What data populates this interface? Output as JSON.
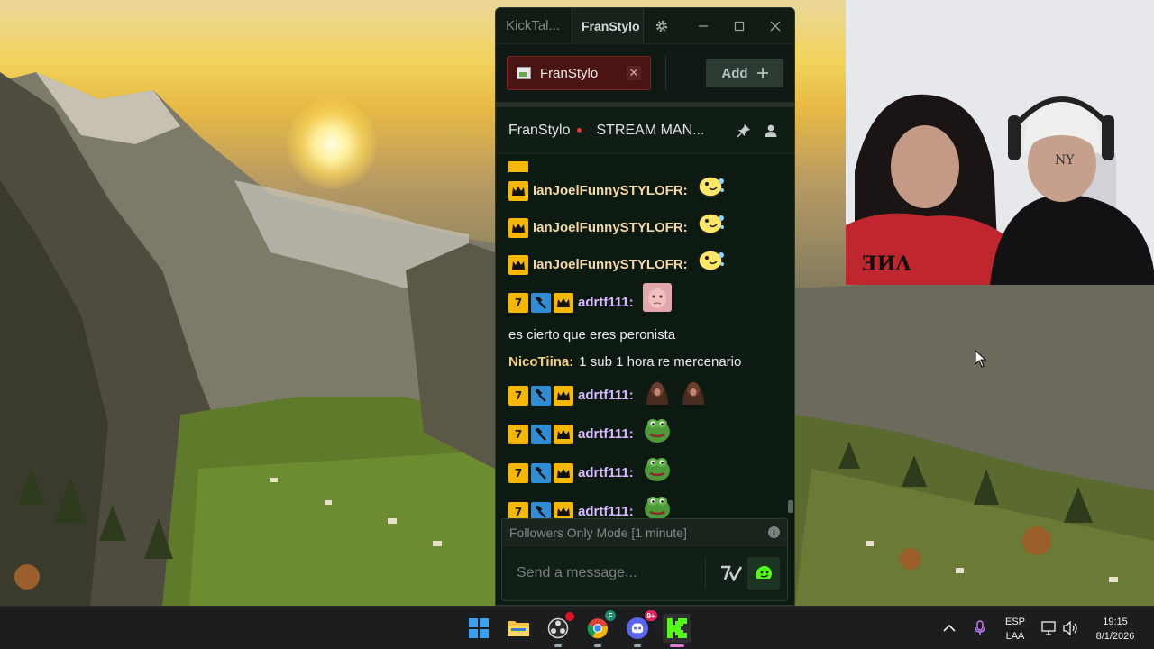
{
  "chat_app": {
    "app_title": "KickTal...",
    "active_tab": "FranStylo",
    "channel_tabs": [
      {
        "label": "FranStylo"
      }
    ],
    "add_label": "Add",
    "stream": {
      "channel": "FranStylo",
      "title": "STREAM MAÑ..."
    },
    "messages": [
      {
        "user": "IanJoelFunnySTYLOFR:",
        "badges": [
          "crown"
        ],
        "emotes": [
          "yellow-blob"
        ],
        "text": ""
      },
      {
        "user": "IanJoelFunnySTYLOFR:",
        "badges": [
          "crown"
        ],
        "emotes": [
          "yellow-blob"
        ],
        "text": ""
      },
      {
        "user": "IanJoelFunnySTYLOFR:",
        "badges": [
          "crown"
        ],
        "emotes": [
          "yellow-blob"
        ],
        "text": ""
      },
      {
        "user": "adrtf111:",
        "badges": [
          "seven",
          "hammer",
          "crown"
        ],
        "emotes": [
          "pink-face"
        ],
        "text": "es cierto que eres peronista"
      },
      {
        "user": "NicoTiina:",
        "badges": [],
        "emotes": [],
        "text": "1 sub 1 hora re mercenario"
      },
      {
        "user": "adrtf111:",
        "badges": [
          "seven",
          "hammer",
          "crown"
        ],
        "emotes": [
          "monkey",
          "monkey"
        ],
        "text": ""
      },
      {
        "user": "adrtf111:",
        "badges": [
          "seven",
          "hammer",
          "crown"
        ],
        "emotes": [
          "pepe"
        ],
        "text": ""
      },
      {
        "user": "adrtf111:",
        "badges": [
          "seven",
          "hammer",
          "crown"
        ],
        "emotes": [
          "pepe"
        ],
        "text": ""
      },
      {
        "user": "adrtf111:",
        "badges": [
          "seven",
          "hammer",
          "crown"
        ],
        "emotes": [
          "pepe"
        ],
        "text": ""
      }
    ],
    "composer": {
      "mode_notice": "Followers Only Mode [1 minute]",
      "placeholder": "Send a message..."
    }
  },
  "taskbar": {
    "apps": [
      "start",
      "file-explorer",
      "obs",
      "chrome",
      "discord",
      "kick"
    ],
    "discord_badge": "9+",
    "language_line1": "ESP",
    "language_line2": "LAA",
    "time": "19:15",
    "date": "8/1/2026"
  },
  "colors": {
    "accent_green": "#53fc18",
    "badge_gold": "#f5b700",
    "badge_blue": "#2f8dd6",
    "tab_red": "#4a1414"
  }
}
